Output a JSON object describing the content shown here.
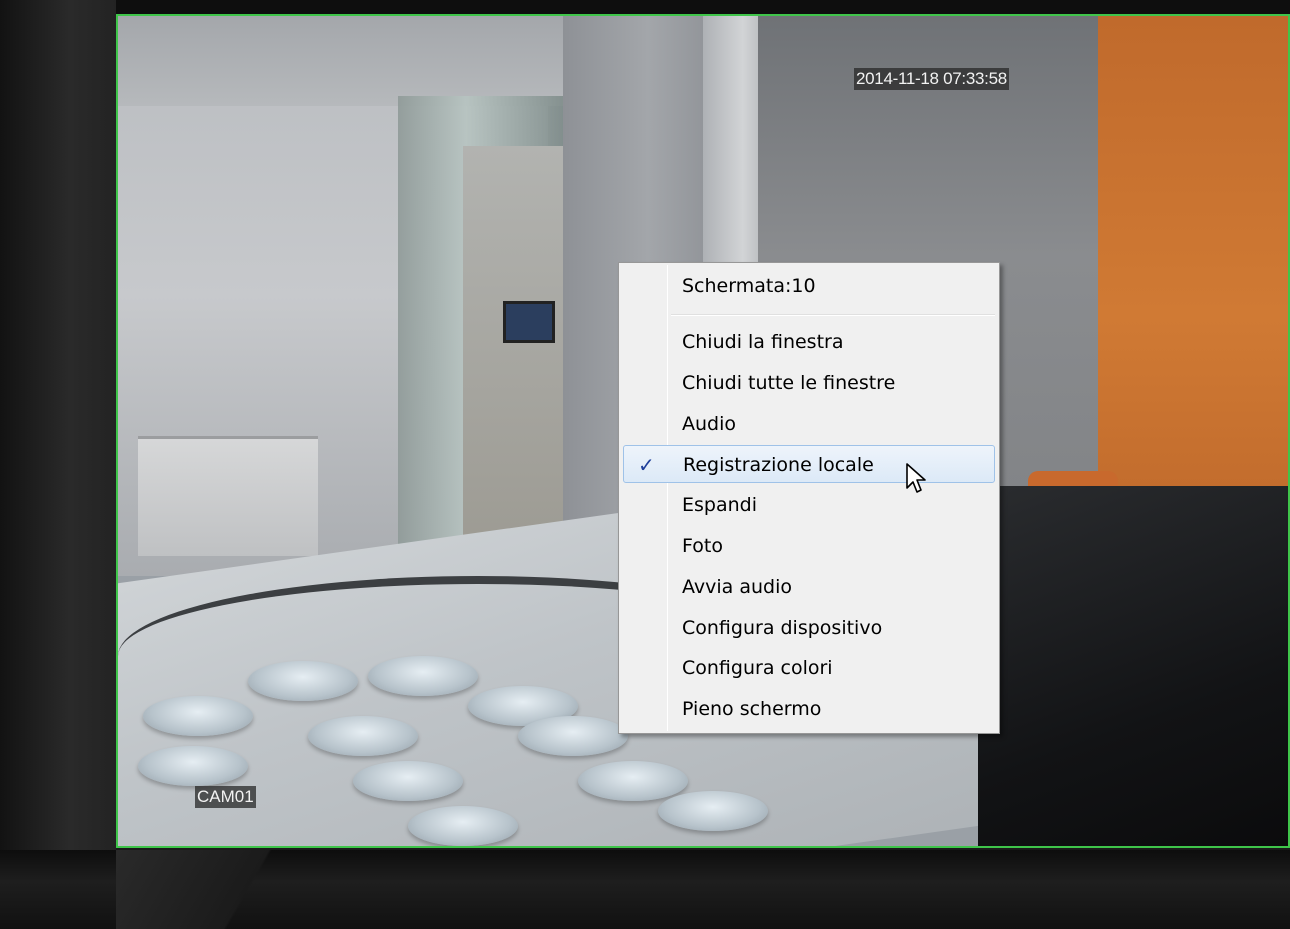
{
  "video": {
    "timestamp": "2014-11-18 07:33:58",
    "camera_label": "CAM01"
  },
  "context_menu": {
    "header_item": "Schermata:10",
    "items": [
      {
        "label": "Chiudi la finestra",
        "checked": false
      },
      {
        "label": "Chiudi tutte le finestre",
        "checked": false
      },
      {
        "label": "Audio",
        "checked": false
      },
      {
        "label": "Registrazione locale",
        "checked": true,
        "hovered": true
      },
      {
        "label": "Espandi",
        "checked": false
      },
      {
        "label": "Foto",
        "checked": false
      },
      {
        "label": "Avvia audio",
        "checked": false
      },
      {
        "label": "Configura dispositivo",
        "checked": false
      },
      {
        "label": "Configura colori",
        "checked": false
      },
      {
        "label": "Pieno schermo",
        "checked": false
      }
    ],
    "check_glyph": "✓"
  },
  "colors": {
    "window_border": "#3fc54a",
    "menu_bg": "#f0f0f0",
    "menu_hover": "#dce9f7",
    "check": "#1f3f9a"
  },
  "icons": {
    "cursor": "arrow-cursor-icon",
    "check": "checkmark-icon"
  }
}
